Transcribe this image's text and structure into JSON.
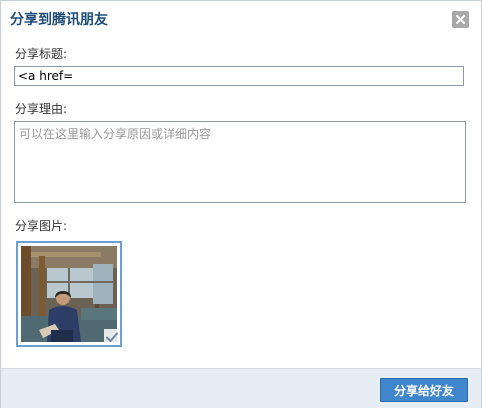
{
  "dialog": {
    "title": "分享到腾讯朋友",
    "close_icon": "close-icon"
  },
  "fields": {
    "title_label": "分享标题:",
    "title_value": "<a href=",
    "reason_label": "分享理由:",
    "reason_placeholder": "可以在这里输入分享原因或详细内容",
    "image_label": "分享图片:"
  },
  "image": {
    "selected": true,
    "check_icon": "checkmark-icon"
  },
  "footer": {
    "share_button": "分享给好友"
  },
  "colors": {
    "title": "#1f4d78",
    "button": "#3f86cd",
    "footer_bg": "#e6eef3",
    "thumb_border": "#6d9ed6"
  }
}
